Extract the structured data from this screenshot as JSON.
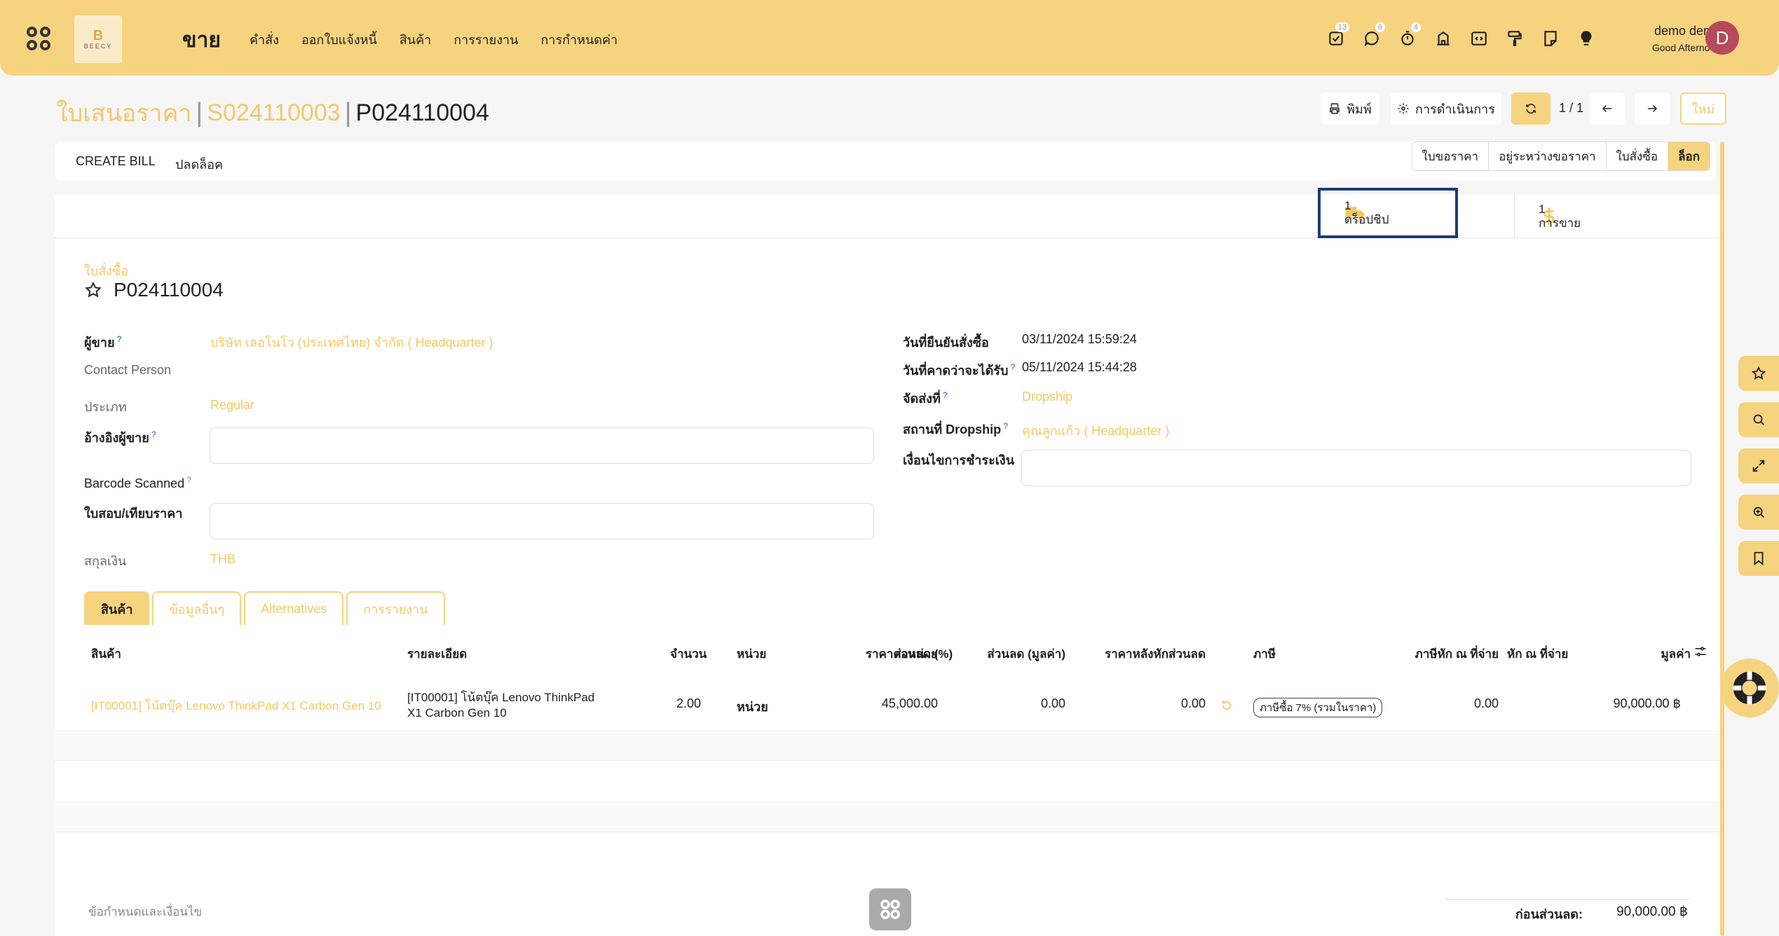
{
  "navbar": {
    "logo_letter": "B",
    "logo_text": "BEECY",
    "app_title": "ขาย",
    "menu": [
      "คำสั่ง",
      "ออกใบแจ้งหนี้",
      "สินค้า",
      "การรายงาน",
      "การกำหนดค่า"
    ],
    "badges": {
      "activities": "13",
      "messages": "6",
      "timer": "4"
    },
    "user_name": "demo demo",
    "user_greeting": "Good Afternoon",
    "avatar_letter": "D"
  },
  "breadcrumb": {
    "root": "ใบเสนอราคา",
    "parent": "S024110003",
    "current": "P024110004"
  },
  "control": {
    "print_label": "พิมพ์",
    "action_label": "การดำเนินการ",
    "pager": "1 / 1",
    "new_label": "ใหม่"
  },
  "statusbar": {
    "buttons": [
      "CREATE BILL",
      "ปลดล็อค"
    ],
    "stages": [
      "ใบขอราคา",
      "อยู่ระหว่างขอราคา",
      "ใบสั่งซื้อ",
      "ล็อก"
    ],
    "active_stage": "ล็อก"
  },
  "smart_buttons": {
    "dropship": {
      "count": "1",
      "label": "ดร็อปชิป"
    },
    "sales": {
      "count": "1",
      "label": "การขาย"
    }
  },
  "form": {
    "subtitle": "ใบสั่งซื้อ",
    "title": "P024110004",
    "vendor_label": "ผู้ขาย",
    "vendor_value": "บริษัท เลอโนโว (ประเทศไทย) จำกัด ( Headquarter )",
    "contact_label": "Contact Person",
    "type_label": "ประเภท",
    "type_value": "Regular",
    "vendor_ref_label": "อ้างอิงผู้ขาย",
    "barcode_label": "Barcode Scanned",
    "rfq_label": "ใบสอบ/เทียบราคา",
    "currency_label": "สกุลเงิน",
    "currency_value": "THB",
    "confirm_date_label": "วันที่ยืนยันสั่งซื้อ",
    "confirm_date_value": "03/11/2024 15:59:24",
    "expected_date_label": "วันที่คาดว่าจะได้รับ",
    "expected_date_value": "05/11/2024 15:44:28",
    "deliver_to_label": "จัดส่งที่",
    "deliver_to_value": "Dropship",
    "dropship_address_label": "สถานที่ Dropship",
    "dropship_address_value": "คุณลูกแก้ว ( Headquarter )",
    "payment_terms_label": "เงื่อนไขการชำระเงิน"
  },
  "tabs": [
    "สินค้า",
    "ข้อมูลอื่นๆ",
    "Alternatives",
    "การรายงาน"
  ],
  "table": {
    "headers": [
      "สินค้า",
      "รายละเอียด",
      "จำนวน",
      "หน่วย",
      "ราคาต่อหน่วย",
      "ส่วนลด (%)",
      "ส่วนลด (มูลค่า)",
      "ราคาหลังหักส่วนลด",
      "ภาษี",
      "ภาษีหัก ณ ที่จ่าย",
      "หัก ณ ที่จ่าย",
      "มูลค่า"
    ],
    "rows": [
      {
        "product": "[IT00001] โน้ตบุ๊ค Lenovo ThinkPad X1 Carbon Gen 10",
        "desc_line1": "[IT00001] โน้ตบุ๊ค Lenovo ThinkPad",
        "desc_line2": "X1 Carbon Gen 10",
        "qty": "2.00",
        "uom": "หน่วย",
        "price": "45,000.00",
        "discount_amount": "0.00",
        "price_after_discount": "0.00",
        "tax": "ภาษีซื้อ 7% (รวมในราคา)",
        "wht": "0.00",
        "subtotal": "90,000.00 ฿"
      }
    ]
  },
  "footer": {
    "terms_placeholder": "ข้อกำหนดและเงื่อนไข",
    "before_discount_label": "ก่อนส่วนลด:",
    "before_discount_value": "90,000.00 ฿"
  },
  "colors": {
    "accent": "#f6d37f",
    "accent_text": "#f3c767",
    "highlight_border": "#1f3b78"
  }
}
